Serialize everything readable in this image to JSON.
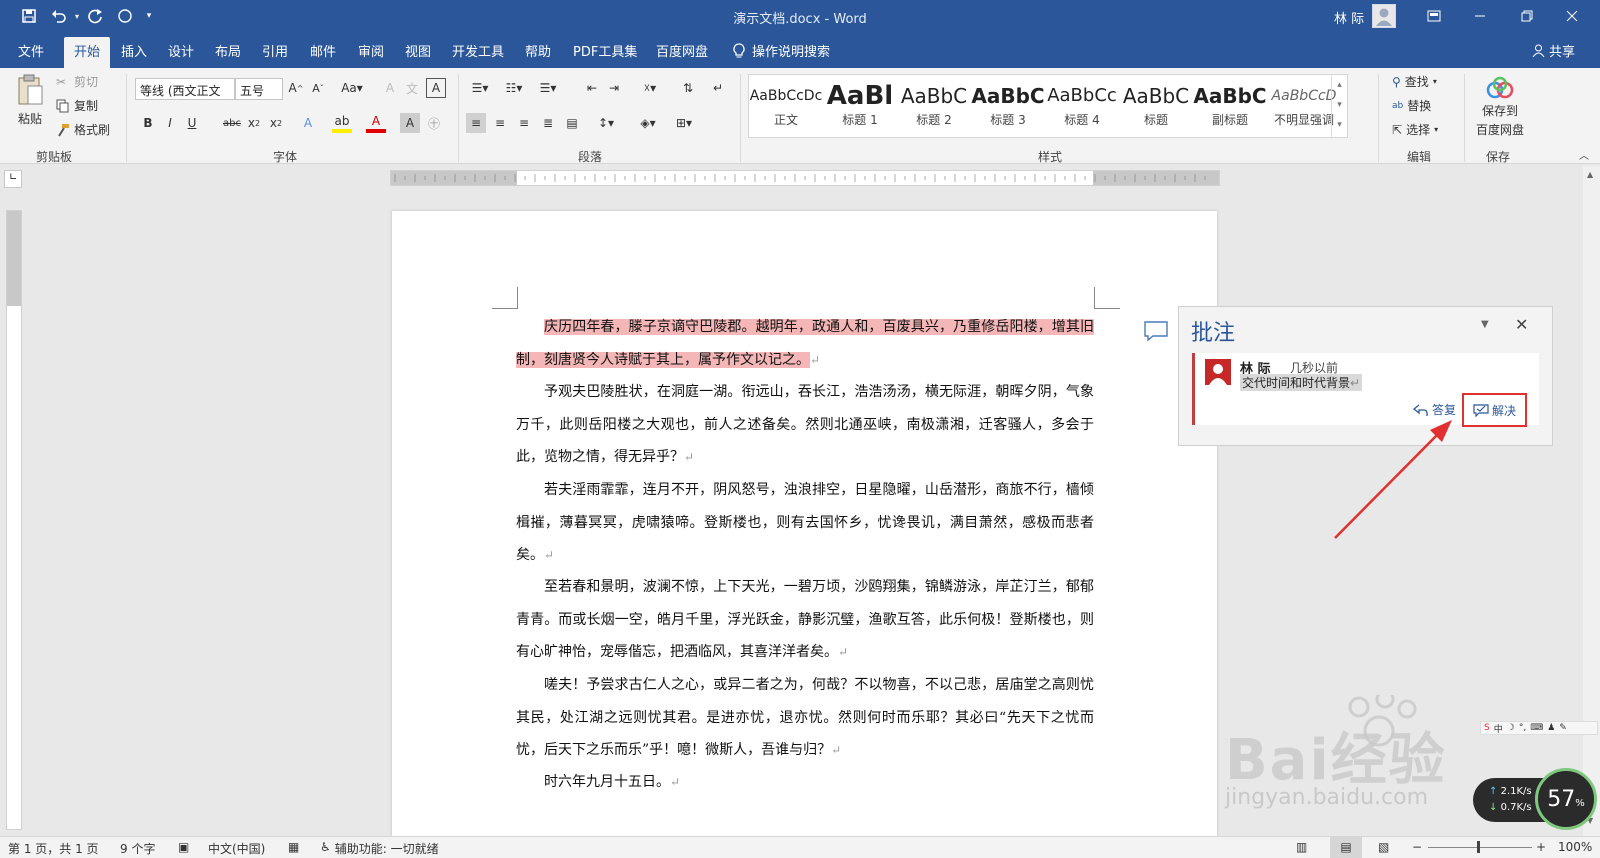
{
  "window": {
    "title": "演示文档.docx - Word",
    "user_name": "林 际"
  },
  "tabs": [
    {
      "label": "文件"
    },
    {
      "label": "开始"
    },
    {
      "label": "插入"
    },
    {
      "label": "设计"
    },
    {
      "label": "布局"
    },
    {
      "label": "引用"
    },
    {
      "label": "邮件"
    },
    {
      "label": "审阅"
    },
    {
      "label": "视图"
    },
    {
      "label": "开发工具"
    },
    {
      "label": "帮助"
    },
    {
      "label": "PDF工具集"
    },
    {
      "label": "百度网盘"
    }
  ],
  "tell_me": "操作说明搜索",
  "share_label": "共享",
  "ribbon": {
    "clipboard": {
      "paste": "粘贴",
      "cut": "剪切",
      "copy": "复制",
      "format_painter": "格式刷",
      "group_label": "剪贴板"
    },
    "font": {
      "font_name": "等线 (西文正文",
      "font_size": "五号",
      "group_label": "字体"
    },
    "paragraph": {
      "group_label": "段落"
    },
    "styles": {
      "group_label": "样式",
      "items": [
        {
          "preview": "AaBbCcDc",
          "name": "正文"
        },
        {
          "preview": "AaBl",
          "name": "标题 1"
        },
        {
          "preview": "AaBbC",
          "name": "标题 2"
        },
        {
          "preview": "AaBbC",
          "name": "标题 3"
        },
        {
          "preview": "AaBbCc",
          "name": "标题 4"
        },
        {
          "preview": "AaBbC",
          "name": "标题"
        },
        {
          "preview": "AaBbC",
          "name": "副标题"
        },
        {
          "preview": "AaBbCcD",
          "name": "不明显强调"
        }
      ]
    },
    "editing": {
      "find": "查找",
      "replace": "替换",
      "select": "选择",
      "group_label": "编辑"
    },
    "save": {
      "line1": "保存到",
      "line2": "百度网盘",
      "group_label": "保存"
    }
  },
  "document": {
    "paragraphs": [
      {
        "text": "庆历四年春，滕子京谪守巴陵郡。越明年，政通人和，百废具兴，乃重修岳阳楼，增其旧制，刻唐贤今人诗赋于其上，属予作文以记之。",
        "highlighted": true
      },
      {
        "text": "予观夫巴陵胜状，在洞庭一湖。衔远山，吞长江，浩浩汤汤，横无际涯，朝晖夕阴，气象万千，此则岳阳楼之大观也，前人之述备矣。然则北通巫峡，南极潇湘，迁客骚人，多会于此，览物之情，得无异乎？"
      },
      {
        "text": "若夫淫雨霏霏，连月不开，阴风怒号，浊浪排空，日星隐曜，山岳潜形，商旅不行，樯倾楫摧，薄暮冥冥，虎啸猿啼。登斯楼也，则有去国怀乡，忧谗畏讥，满目萧然，感极而悲者矣。"
      },
      {
        "text": "至若春和景明，波澜不惊，上下天光，一碧万顷，沙鸥翔集，锦鳞游泳，岸芷汀兰，郁郁青青。而或长烟一空，皓月千里，浮光跃金，静影沉璧，渔歌互答，此乐何极！登斯楼也，则有心旷神怡，宠辱偕忘，把酒临风，其喜洋洋者矣。"
      },
      {
        "text": "嗟夫！予尝求古仁人之心，或异二者之为，何哉？不以物喜，不以己悲，居庙堂之高则忧其民，处江湖之远则忧其君。是进亦忧，退亦忧。然则何时而乐耶？其必曰“先天下之忧而忧，后天下之乐而乐”乎！噫！微斯人，吾谁与归？"
      },
      {
        "text": "时六年九月十五日。"
      }
    ],
    "paragraph_mark": "↵"
  },
  "comments_pane": {
    "title": "批注",
    "comment": {
      "author": "林 际",
      "time": "几秒以前",
      "text": "交代时间和时代背景"
    },
    "reply_label": "答复",
    "resolve_label": "解决"
  },
  "status": {
    "page": "第 1 页，共 1 页",
    "words": "9 个字",
    "language": "中文(中国)",
    "accessibility": "辅助功能: 一切就绪",
    "zoom": "100%"
  },
  "overlays": {
    "net_up": "2.1K/s",
    "net_down": "0.7K/s",
    "cpu": "57",
    "cpu_unit": "%",
    "watermark_brand": "Bai经验",
    "watermark_url": "jingyan.baidu.com"
  },
  "colors": {
    "brand": "#2b579a",
    "highlight": "#f4b6b6",
    "annotation": "#e03030"
  }
}
